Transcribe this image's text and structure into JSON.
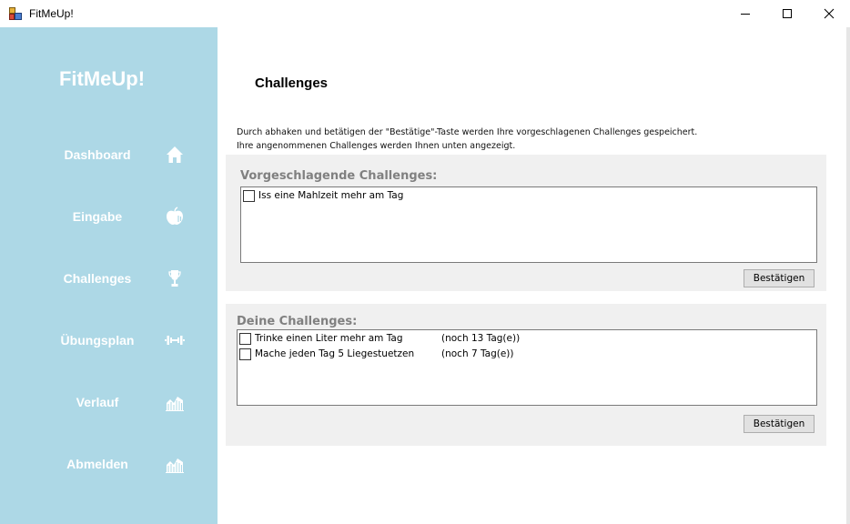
{
  "window": {
    "title": "FitMeUp!",
    "icons": {
      "app": "app-icon",
      "minimize": "minimize-icon",
      "maximize": "maximize-icon",
      "close": "close-icon"
    }
  },
  "sidebar": {
    "brand": "FitMeUp!",
    "background": "#add8e6",
    "items": [
      {
        "label": "Dashboard",
        "icon": "home-icon"
      },
      {
        "label": "Eingabe",
        "icon": "apple-icon"
      },
      {
        "label": "Challenges",
        "icon": "trophy-icon"
      },
      {
        "label": "Übungsplan",
        "icon": "dumbbell-icon"
      },
      {
        "label": "Verlauf",
        "icon": "chart-icon"
      },
      {
        "label": "Abmelden",
        "icon": "chart-icon"
      }
    ]
  },
  "main": {
    "title": "Challenges",
    "description": [
      "Durch abhaken und betätigen der \"Bestätige\"-Taste werden Ihre vorgeschlagenen Challenges gespeichert.",
      "Ihre angenommenen Challenges werden Ihnen unten angezeigt."
    ],
    "suggested": {
      "title": "Vorgeschlagende Challenges:",
      "items": [
        {
          "label": "Iss eine Mahlzeit mehr am Tag",
          "checked": false
        }
      ],
      "button": "Bestätigen"
    },
    "mine": {
      "title": "Deine Challenges:",
      "items": [
        {
          "label": "Trinke einen Liter mehr am Tag",
          "remaining": "(noch 13 Tag(e))",
          "checked": false
        },
        {
          "label": "Mache jeden Tag 5 Liegestuetzen",
          "remaining": "(noch 7 Tag(e))",
          "checked": false
        }
      ],
      "button": "Bestätigen"
    }
  }
}
